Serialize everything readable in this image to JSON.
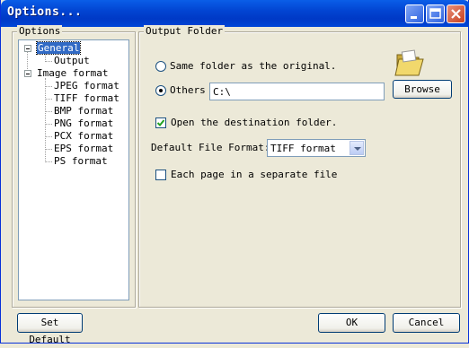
{
  "window": {
    "title": "Options..."
  },
  "options_tree": {
    "legend": "Options",
    "general_label": "General",
    "output_label": "Output",
    "image_format_label": "Image format",
    "formats": [
      "JPEG format",
      "TIFF format",
      "BMP format",
      "PNG format",
      "PCX format",
      "EPS format",
      "PS format"
    ]
  },
  "output_folder": {
    "legend": "Output Folder",
    "same_folder_label": "Same folder as the original.",
    "others_label": "Others",
    "others_path": "C:\\",
    "browse_label": "Browse",
    "open_destination_label": "Open the destination folder.",
    "open_destination_checked": true,
    "default_format_label": "Default File Format:",
    "default_format_value": "TIFF format",
    "each_page_label": "Each page in a separate file",
    "each_page_checked": false
  },
  "footer": {
    "set_default_label": "Set Default",
    "ok_label": "OK",
    "cancel_label": "Cancel"
  }
}
